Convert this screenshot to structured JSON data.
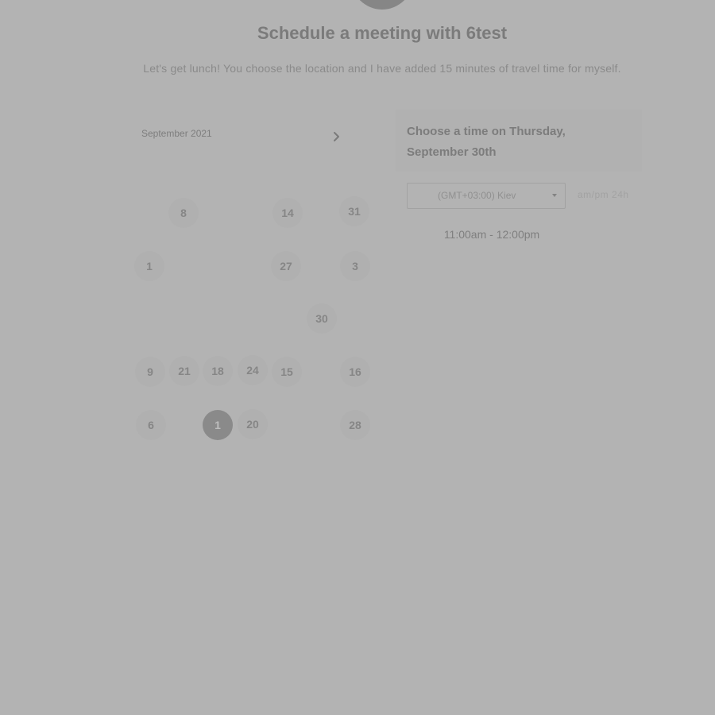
{
  "header": {
    "title": "Schedule a meeting with 6test",
    "description": "Let's get lunch! You choose the location and I have added 15 minutes of travel time for myself."
  },
  "calendar": {
    "month_label": "September 2021",
    "next_icon": "chevron-right-icon",
    "days": [
      "8",
      "14",
      "31",
      "1",
      "27",
      "3",
      "30",
      "9",
      "21",
      "18",
      "24",
      "15",
      "16",
      "6",
      "1",
      "20",
      "28"
    ],
    "selected_day": "1"
  },
  "right_panel": {
    "heading": "Choose a time on Thursday, September 30th",
    "timezone": {
      "label": "(GMT+03:00) Kiev",
      "icon": "caret-down-icon"
    },
    "time_format": {
      "am_pm": "am/pm",
      "h24": "24h"
    },
    "slots": [
      "11:00am - 12:00pm"
    ]
  },
  "colors": {
    "overlay_background": "#b3b3b3",
    "selected_day": "#8a8a8a"
  }
}
